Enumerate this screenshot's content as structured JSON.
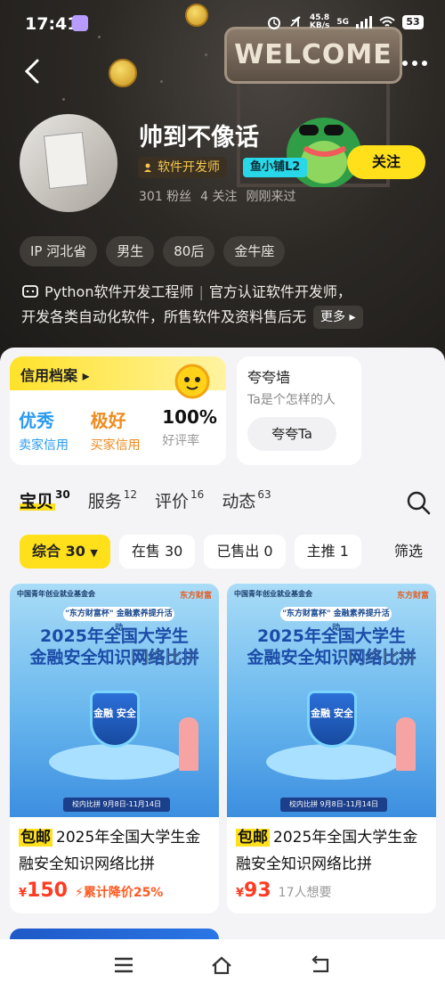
{
  "status": {
    "time": "17:41",
    "net_speed": "45.8",
    "net_unit": "KB/s",
    "net_type": "5G",
    "battery": "53"
  },
  "profile": {
    "name": "帅到不像话",
    "badge_dev": "软件开发师",
    "badge_level": "鱼小铺L2",
    "follow_label": "关注",
    "stats": [
      "301 粉丝",
      "4 关注",
      "刚刚来过"
    ],
    "tags": [
      "IP 河北省",
      "男生",
      "80后",
      "金牛座"
    ],
    "bio_line1_a": "Python软件开发工程师",
    "bio_line1_b": "官方认证软件开发师，",
    "bio_line2": "开发各类自动化软件，所售软件及资料售后无",
    "more_label": "更多",
    "banner_text": "WELCOME"
  },
  "credit": {
    "title": "信用档案",
    "cols": [
      {
        "big": "优秀",
        "small": "卖家信用"
      },
      {
        "big": "极好",
        "small": "买家信用"
      },
      {
        "big": "100%",
        "small": "好评率"
      }
    ]
  },
  "praise": {
    "title": "夸夸墙",
    "sub": "Ta是个怎样的人",
    "button": "夸夸Ta"
  },
  "tabs": [
    {
      "label": "宝贝",
      "count": "30"
    },
    {
      "label": "服务",
      "count": "12"
    },
    {
      "label": "评价",
      "count": "16"
    },
    {
      "label": "动态",
      "count": "63"
    }
  ],
  "filters": [
    "综合 30",
    "在售 30",
    "已售出 0",
    "主推 1"
  ],
  "filter_end": "筛选",
  "products": [
    {
      "poster_org": "中国青年创业就业基金会",
      "poster_brand": "东方财富",
      "poster_ribbon": "\"东方财富杯\" 金融素养提升活动",
      "poster_title1": "2025年全国大学生",
      "poster_title2a": "金融安全知识",
      "poster_title2b": "网络比拼",
      "poster_shield": "金融 安全",
      "poster_bottom": "校内比拼  9月8日-11月14日",
      "free": "包邮",
      "title": "2025年全国大学生金融安全知识网络比拼",
      "price_symbol": "¥",
      "price": "150",
      "extra": "累计降价25%"
    },
    {
      "poster_org": "中国青年创业就业基金会",
      "poster_brand": "东方财富",
      "poster_ribbon": "\"东方财富杯\" 金融素养提升活动",
      "poster_title1": "2025年全国大学生",
      "poster_title2a": "金融安全知识",
      "poster_title2b": "网络比拼",
      "poster_shield": "金融 安全",
      "poster_bottom": "校内比拼  9月8日-11月14日",
      "free": "包邮",
      "title": "2025年全国大学生金融安全知识网络比拼",
      "price_symbol": "¥",
      "price": "93",
      "extra": "17人想要"
    }
  ],
  "colors": {
    "accent": "#ffe01b",
    "price": "#ff3b22",
    "header_bg": "#2c2925"
  }
}
